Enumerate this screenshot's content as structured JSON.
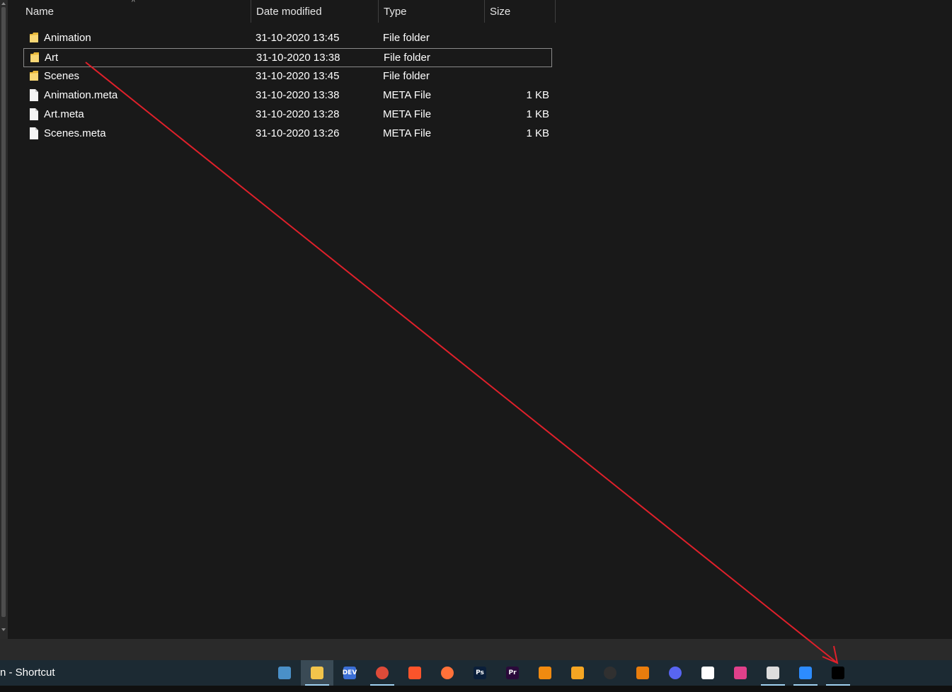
{
  "columns": {
    "name": "Name",
    "date": "Date modified",
    "type": "Type",
    "size": "Size"
  },
  "files": [
    {
      "name": "Animation",
      "date": "31-10-2020 13:45",
      "type": "File folder",
      "size": "",
      "kind": "folder"
    },
    {
      "name": "Art",
      "date": "31-10-2020 13:38",
      "type": "File folder",
      "size": "",
      "kind": "folder",
      "selected": true
    },
    {
      "name": "Scenes",
      "date": "31-10-2020 13:45",
      "type": "File folder",
      "size": "",
      "kind": "folder"
    },
    {
      "name": "Animation.meta",
      "date": "31-10-2020 13:38",
      "type": "META File",
      "size": "1 KB",
      "kind": "file"
    },
    {
      "name": "Art.meta",
      "date": "31-10-2020 13:28",
      "type": "META File",
      "size": "1 KB",
      "kind": "file"
    },
    {
      "name": "Scenes.meta",
      "date": "31-10-2020 13:26",
      "type": "META File",
      "size": "1 KB",
      "kind": "file"
    }
  ],
  "taskbar": {
    "shortcut_label": "n - Shortcut",
    "apps": [
      {
        "name": "desktop-app-icon",
        "color": "#4a90c8",
        "glyph": ""
      },
      {
        "name": "file-explorer-icon",
        "color": "#f2c44b",
        "glyph": "",
        "active": true,
        "running": true
      },
      {
        "name": "dev-icon",
        "color": "#3b6fd6",
        "glyph": "DEV"
      },
      {
        "name": "chrome-icon",
        "color": "#dd4b39",
        "glyph": "",
        "running": true
      },
      {
        "name": "brave-icon",
        "color": "#fb542b",
        "glyph": ""
      },
      {
        "name": "firefox-icon",
        "color": "#ff7139",
        "glyph": ""
      },
      {
        "name": "photoshop-icon",
        "color": "#0b1f3a",
        "glyph": "Ps"
      },
      {
        "name": "premiere-icon",
        "color": "#2a0a3a",
        "glyph": "Pr"
      },
      {
        "name": "vlc-icon",
        "color": "#f08a10",
        "glyph": ""
      },
      {
        "name": "fl-studio-icon",
        "color": "#f5a623",
        "glyph": ""
      },
      {
        "name": "obs-icon",
        "color": "#303030",
        "glyph": ""
      },
      {
        "name": "blender-icon",
        "color": "#e87d0d",
        "glyph": ""
      },
      {
        "name": "discord-icon",
        "color": "#5865f2",
        "glyph": ""
      },
      {
        "name": "sketch-icon",
        "color": "#ffffff",
        "glyph": ""
      },
      {
        "name": "mirror-icon",
        "color": "#e0408a",
        "glyph": ""
      },
      {
        "name": "unity-hub-icon",
        "color": "#dddddd",
        "glyph": "",
        "running": true
      },
      {
        "name": "zoom-icon",
        "color": "#2d8cff",
        "glyph": "",
        "running": true
      },
      {
        "name": "unity-icon",
        "color": "#000000",
        "glyph": "",
        "running": true
      }
    ]
  },
  "colors": {
    "annotation_arrow": "#e0202a",
    "background": "#191919",
    "taskbar": "#1c2a33",
    "running_indicator": "#9fd0f0"
  }
}
